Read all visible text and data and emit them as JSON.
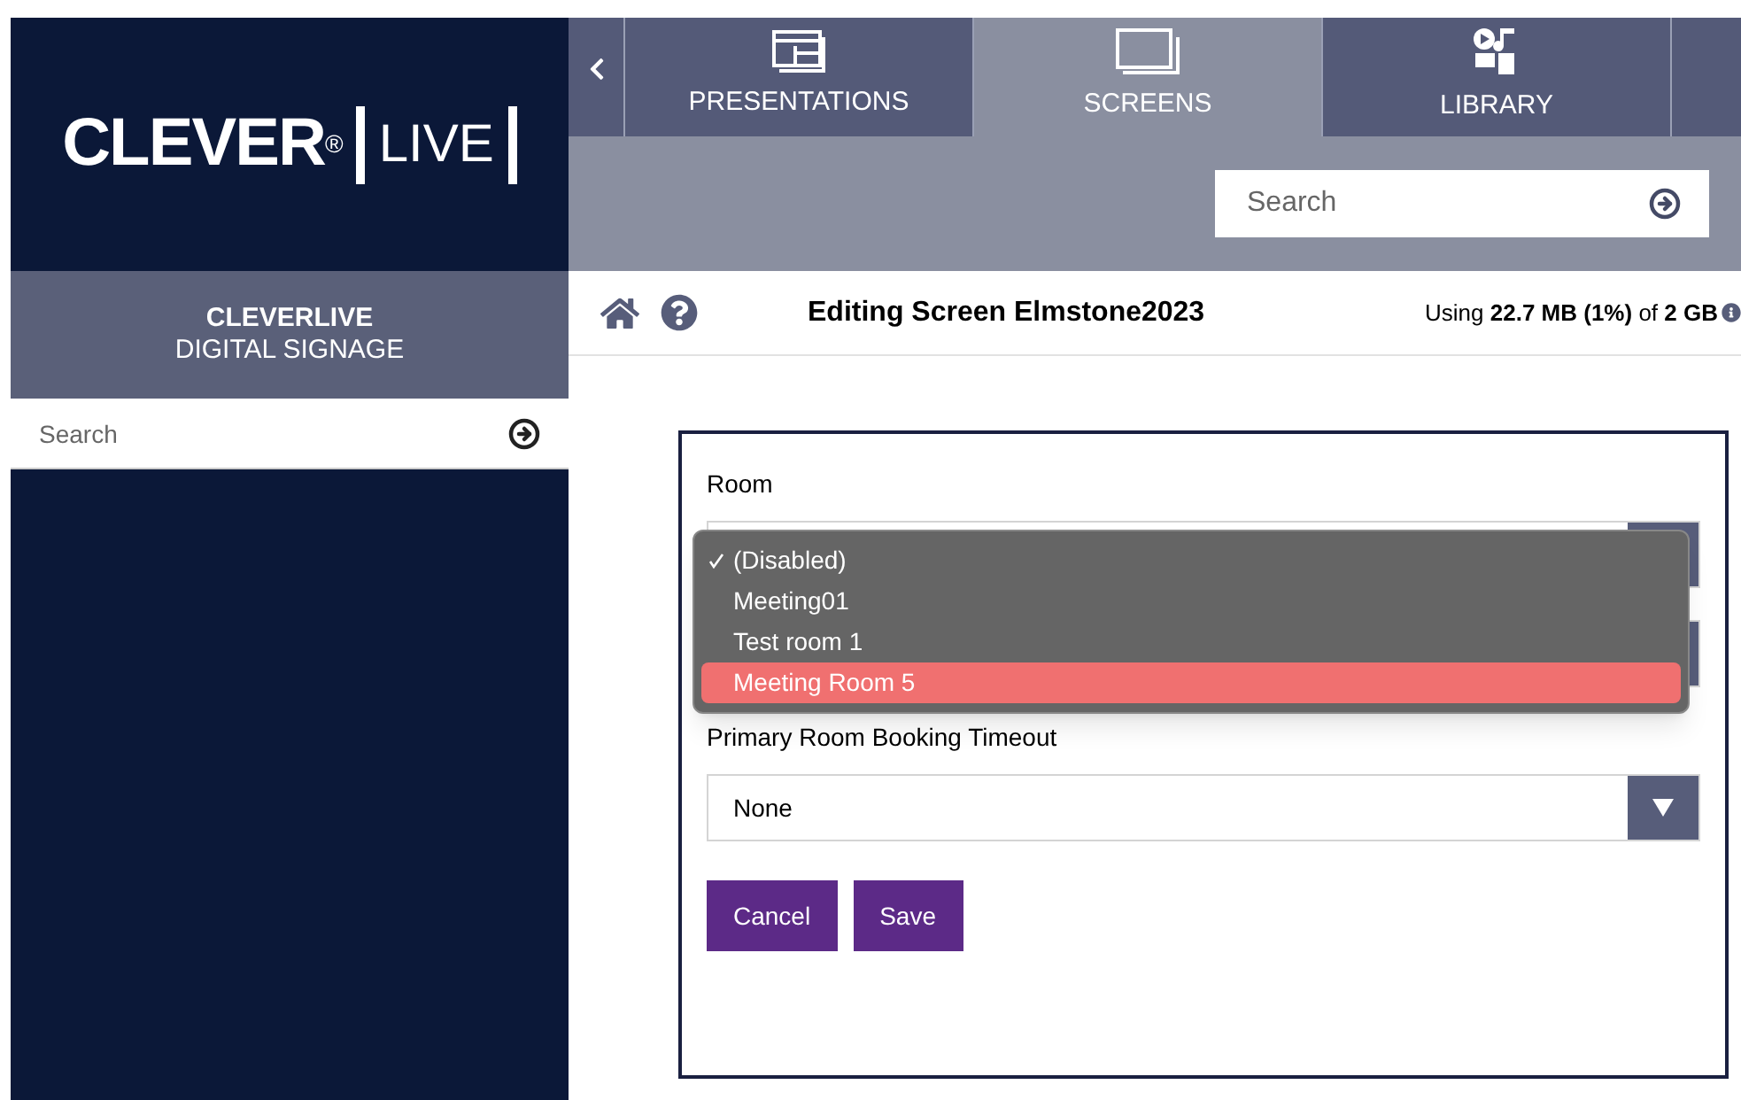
{
  "logo": {
    "brand": "CLEVER",
    "mark": "®",
    "word": "LIVE"
  },
  "sidebar": {
    "title": "CLEVERLIVE",
    "subtitle": "DIGITAL SIGNAGE",
    "search": {
      "placeholder": "Search"
    }
  },
  "tabs": [
    {
      "label": "PRESENTATIONS",
      "kind": "presentation",
      "selected": false
    },
    {
      "label": "SCREENS",
      "kind": "screen",
      "selected": true
    },
    {
      "label": "LIBRARY",
      "kind": "library",
      "selected": false
    }
  ],
  "top_search": {
    "placeholder": "Search"
  },
  "header": {
    "title": "Editing Screen Elmstone2023",
    "usage": "Using **22.7 MB (1%)** of **2 GB**"
  },
  "form": {
    "fields": [
      {
        "label": "Room",
        "kind": "select"
      },
      {
        "kind": "select"
      },
      {
        "label": "Primary Room Booking Timeout",
        "kind": "select",
        "value": "None"
      }
    ],
    "room_menu": [
      {
        "label": "(Disabled)",
        "checked": true,
        "highlighted": false
      },
      {
        "label": "Meeting01",
        "checked": false,
        "highlighted": false
      },
      {
        "label": "Test room 1",
        "checked": false,
        "highlighted": false
      },
      {
        "label": "Meeting Room 5",
        "checked": false,
        "highlighted": true
      }
    ],
    "buttons": [
      "Cancel",
      "Save"
    ]
  }
}
